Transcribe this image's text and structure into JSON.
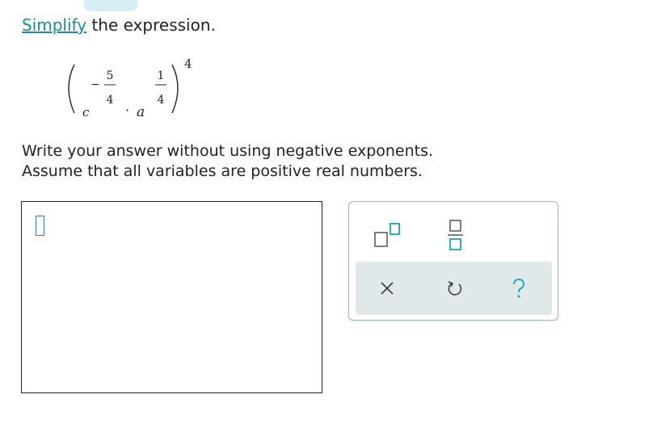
{
  "question": {
    "link_text": "Simplify",
    "rest_text": "the expression."
  },
  "expression": {
    "base1": "c",
    "exp1_sign": "−",
    "exp1_num": "5",
    "exp1_den": "4",
    "dot": "·",
    "base2": "a",
    "exp2_num": "1",
    "exp2_den": "4",
    "outer_exponent": "4"
  },
  "directions": {
    "line1": "Write your answer without using negative exponents.",
    "line2": "Assume that all variables are positive real numbers."
  },
  "palette": {
    "icons": [
      "exponent-template-icon",
      "fraction-template-icon",
      "clear-icon",
      "undo-icon",
      "help-icon"
    ],
    "help_label": "?",
    "clear_label": "×",
    "accent_color": "#1aa3b8"
  }
}
